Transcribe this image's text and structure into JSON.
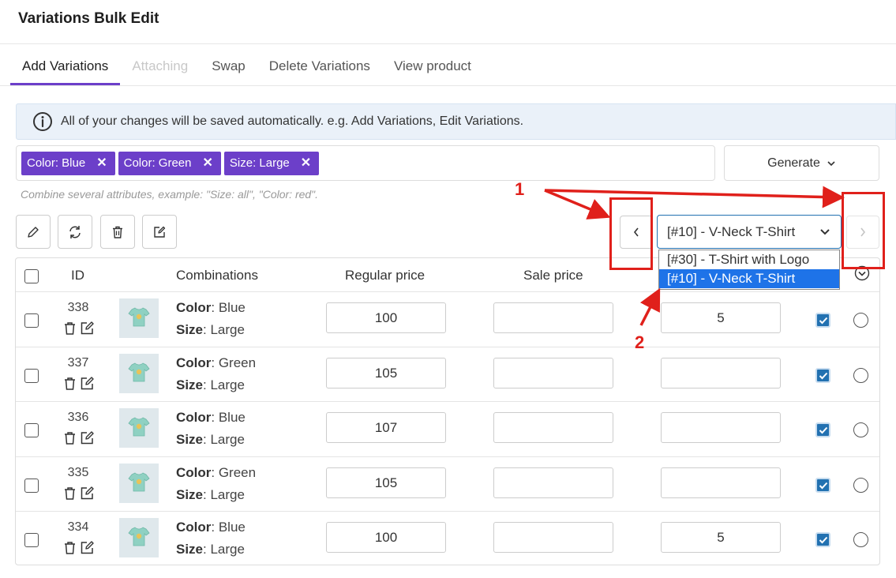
{
  "page_title": "Variations Bulk Edit",
  "tabs": [
    {
      "label": "Add Variations",
      "state": "active"
    },
    {
      "label": "Attaching",
      "state": "disabled"
    },
    {
      "label": "Swap",
      "state": "normal"
    },
    {
      "label": "Delete Variations",
      "state": "normal"
    },
    {
      "label": "View product",
      "state": "normal"
    }
  ],
  "notice": {
    "icon": "info-icon",
    "text": "All of your changes will be saved automatically. e.g. Add Variations, Edit Variations."
  },
  "attribute_tags": [
    {
      "label": "Color: Blue",
      "remove": "✕"
    },
    {
      "label": "Color: Green",
      "remove": "✕"
    },
    {
      "label": "Size: Large",
      "remove": "✕"
    }
  ],
  "generate_label": "Generate",
  "hint": "Combine several attributes, example: \"Size: all\", \"Color: red\".",
  "toolbar_icons": [
    "pencil-icon",
    "refresh-icon",
    "trash-icon",
    "edit-square-icon"
  ],
  "product_select": {
    "value": "[#10] - V-Neck T-Shirt",
    "options": [
      "[#30] - T-Shirt with Logo",
      "[#10] - V-Neck T-Shirt"
    ],
    "selected_index": 1
  },
  "columns": {
    "id": "ID",
    "combinations": "Combinations",
    "regular_price": "Regular price",
    "sale_price": "Sale price"
  },
  "rows": [
    {
      "id": "338",
      "attr1_label": "Color",
      "attr1_value": ": Blue",
      "attr2_label": "Size",
      "attr2_value": ": Large",
      "regular_price": "100",
      "sale_price": "",
      "stock": "5",
      "enabled": true
    },
    {
      "id": "337",
      "attr1_label": "Color",
      "attr1_value": ": Green",
      "attr2_label": "Size",
      "attr2_value": ": Large",
      "regular_price": "105",
      "sale_price": "",
      "stock": "",
      "enabled": true
    },
    {
      "id": "336",
      "attr1_label": "Color",
      "attr1_value": ": Blue",
      "attr2_label": "Size",
      "attr2_value": ": Large",
      "regular_price": "107",
      "sale_price": "",
      "stock": "",
      "enabled": true
    },
    {
      "id": "335",
      "attr1_label": "Color",
      "attr1_value": ": Green",
      "attr2_label": "Size",
      "attr2_value": ": Large",
      "regular_price": "105",
      "sale_price": "",
      "stock": "",
      "enabled": true
    },
    {
      "id": "334",
      "attr1_label": "Color",
      "attr1_value": ": Blue",
      "attr2_label": "Size",
      "attr2_value": ": Large",
      "regular_price": "100",
      "sale_price": "",
      "stock": "5",
      "enabled": true
    }
  ],
  "annotations": {
    "label_1": "1",
    "label_2": "2",
    "color": "#e0201b"
  },
  "colors": {
    "accent": "#6c3fc9",
    "checkbox": "#2271b1",
    "select_highlight": "#1e73e8"
  }
}
